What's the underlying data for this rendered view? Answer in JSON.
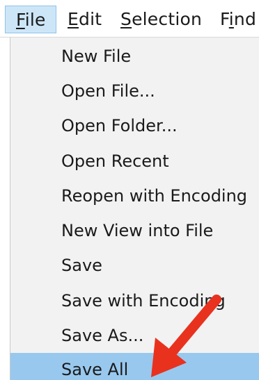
{
  "menubar": {
    "items": [
      {
        "label": "File",
        "mnemonic": "F",
        "rest": "ile",
        "active": true
      },
      {
        "label": "Edit",
        "mnemonic": "E",
        "rest": "dit"
      },
      {
        "label": "Selection",
        "mnemonic": "S",
        "rest": "election"
      },
      {
        "label": "Find",
        "lead": "F",
        "mnemonic": "i",
        "rest": "nd"
      }
    ]
  },
  "file_menu": {
    "items": [
      {
        "label": "New File"
      },
      {
        "label": "Open File..."
      },
      {
        "label": "Open Folder..."
      },
      {
        "label": "Open Recent"
      },
      {
        "label": "Reopen with Encoding"
      },
      {
        "label": "New View into File"
      },
      {
        "label": "Save"
      },
      {
        "label": "Save with Encoding"
      },
      {
        "label": "Save As..."
      },
      {
        "label": "Save All",
        "highlighted": true
      }
    ]
  },
  "colors": {
    "highlight": "#99c8ee",
    "menu_active": "#cde6f7",
    "arrow": "#e8321e"
  },
  "annotation": {
    "icon": "red-arrow-icon",
    "points_to": "Save All"
  }
}
